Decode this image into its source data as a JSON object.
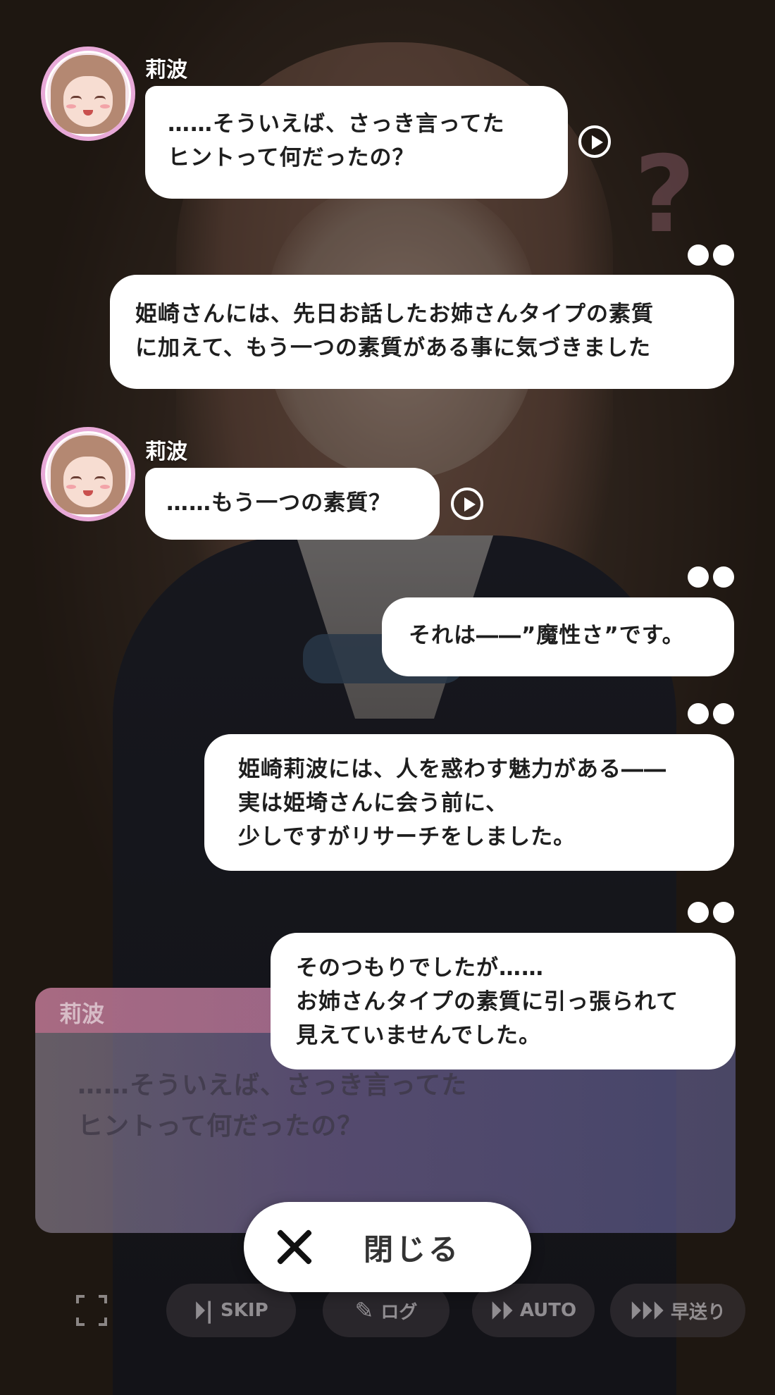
{
  "log": {
    "messages": [
      {
        "speaker": "莉波",
        "text": "……そういえば、さっき言ってた\nヒントって何だったの？"
      },
      {
        "text": "姫崎さんには、先日お話したお姉さんタイプの素質\nに加えて、もう一つの素質がある事に気づきました"
      },
      {
        "speaker": "莉波",
        "text": "……もう一つの素質？"
      },
      {
        "text": "それは――”魔性さ”です。"
      },
      {
        "text": "姫崎莉波には、人を惑わす魅力がある――\n実は姫埼さんに会う前に、\n少しですがリサーチをしました。"
      },
      {
        "text": "そのつもりでしたが……\nお姉さんタイプの素質に引っ張られて\n見えていませんでした。"
      }
    ]
  },
  "message_window": {
    "speaker": "莉波",
    "text": "……そういえば、さっき言ってた\nヒントって何だったの？"
  },
  "close_button": {
    "label": "閉じる"
  },
  "controls": {
    "skip": "SKIP",
    "log": "ログ",
    "auto": "AUTO",
    "fast_forward": "早送り"
  },
  "icons": {
    "play": "play-icon",
    "more": "more-dots-icon",
    "close": "close-icon",
    "fullscreen": "fullscreen-icon",
    "skip": "skip-icon",
    "log": "log-icon",
    "auto": "auto-icon",
    "fast_forward": "fast-forward-icon"
  }
}
